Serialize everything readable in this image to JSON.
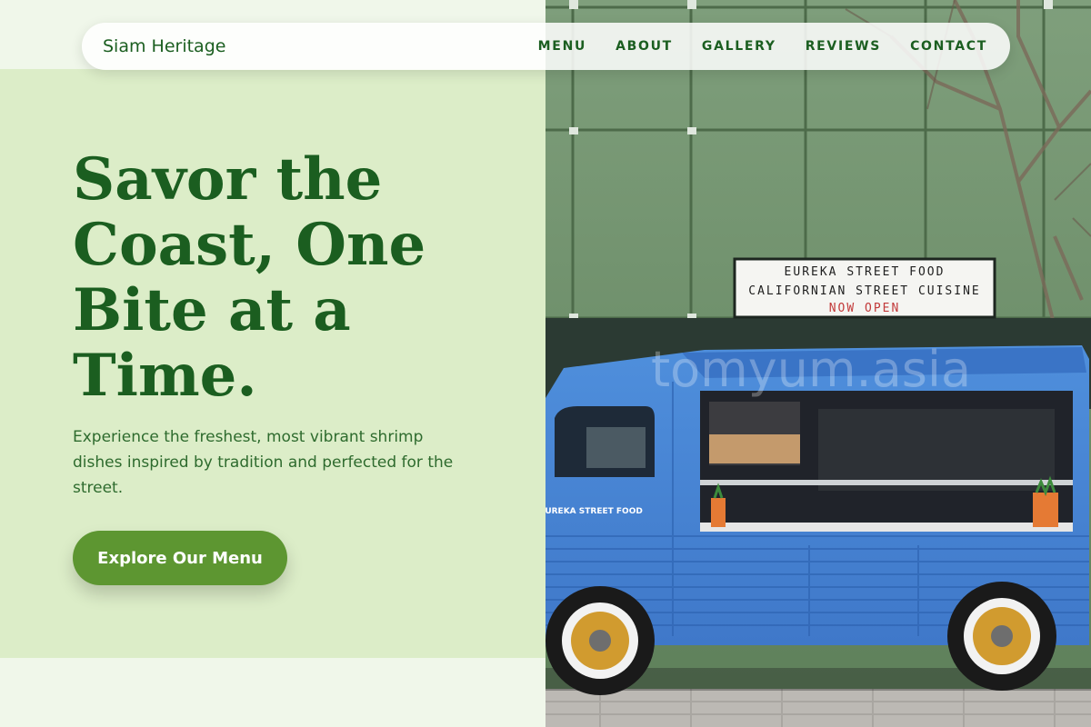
{
  "brand": {
    "name": "Siam Heritage"
  },
  "nav": {
    "items": [
      {
        "label": "MENU"
      },
      {
        "label": "ABOUT"
      },
      {
        "label": "GALLERY"
      },
      {
        "label": "REVIEWS"
      },
      {
        "label": "CONTACT"
      }
    ]
  },
  "hero": {
    "headline": "Savor the Coast, One Bite at a Time.",
    "subtext": "Experience the freshest, most vibrant shrimp dishes inspired by tradition and perfected for the street.",
    "cta_label": "Explore Our Menu"
  },
  "photo": {
    "sign_line_1": "EUREKA STREET FOOD",
    "sign_line_2": "CALIFORNIAN STREET CUISINE",
    "sign_line_3": "NOW OPEN",
    "truck_label": "EUREKA STREET FOOD",
    "watermark": "tomyum.asia"
  },
  "colors": {
    "primary_text": "#1b5e20",
    "accent_button": "#5d9631",
    "hero_background": "#dcedc8",
    "page_background": "#f0f7ea"
  }
}
